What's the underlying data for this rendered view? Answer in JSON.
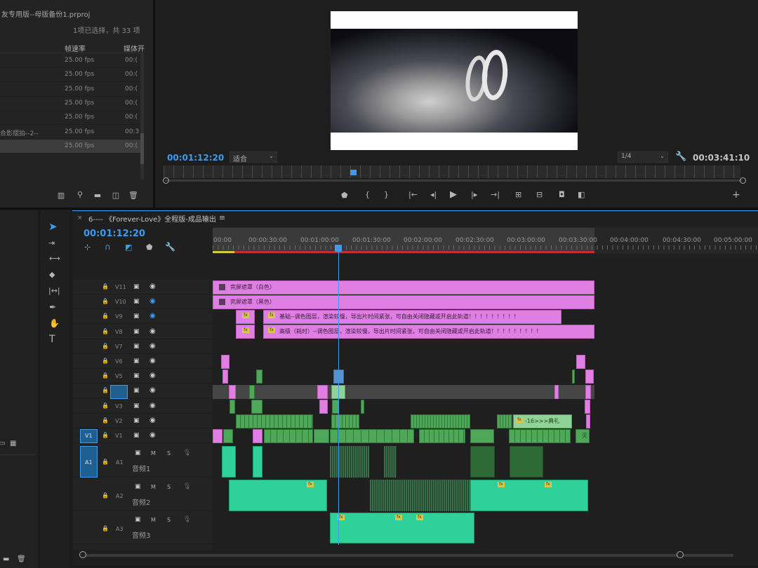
{
  "project": {
    "title": "友专用版--母版备份1.prproj",
    "selection_info": "1项已选择，共 33 项",
    "col_framerate": "帧速率",
    "col_media": "媒体开",
    "rows": [
      {
        "name": "",
        "fps": "25.00 fps",
        "dur": "00:("
      },
      {
        "name": "",
        "fps": "25.00 fps",
        "dur": "00:("
      },
      {
        "name": "",
        "fps": "25.00 fps",
        "dur": "00:("
      },
      {
        "name": "",
        "fps": "25.00 fps",
        "dur": "00:("
      },
      {
        "name": "",
        "fps": "25.00 fps",
        "dur": "00:("
      },
      {
        "name": "合影摆拍--2--",
        "fps": "25.00 fps",
        "dur": "00:3"
      },
      {
        "name": "",
        "fps": "25.00 fps",
        "dur": "00:("
      }
    ]
  },
  "program": {
    "timecode": "00:01:12:20",
    "fit": "适合",
    "resolution": "1/4",
    "duration": "00:03:41:10"
  },
  "timeline": {
    "tab_title": "6---- 《Forever-Love》全程版-成品输出",
    "timecode": "00:01:12:20",
    "ruler": [
      "00:00",
      "00:00:30:00",
      "00:01:00:00",
      "00:01:30:00",
      "00:02:00:00",
      "00:02:30:00",
      "00:03:00:00",
      "00:03:30:00",
      "00:04:00:00",
      "00:04:30:00",
      "00:05:00:00"
    ],
    "video_tracks": [
      "V11",
      "V10",
      "V9",
      "V8",
      "V7",
      "V6",
      "V5",
      "V4",
      "V3",
      "V2",
      "V1"
    ],
    "audio_tracks": [
      {
        "id": "A1",
        "name": "音频1"
      },
      {
        "id": "A2",
        "name": "音频2"
      },
      {
        "id": "A3",
        "name": "音频3"
      }
    ],
    "v1_source": "V1",
    "a1_source": "A1",
    "m_label": "M",
    "s_label": "S",
    "clips": {
      "v11": "完屏遮罩（白色）",
      "v10": "完屏遮罩（黑色）",
      "v9": "基础--调色图层，渲染较慢，导出片时间紧张，可自由关闭隐藏或开启此轨道！！！！！！！！！",
      "v8": "高级（耗时）--调色图层，渲染较慢，导出片时间紧张，可自由关闭隐藏或开启此轨道！！！！！！！！！",
      "v2_label": "-16>>>典礼",
      "v1_end": "灭"
    }
  },
  "colors": {
    "accent": "#3d9bf0",
    "pink": "#e07fe3",
    "green": "#4fa85a",
    "teal": "#2fd19a"
  }
}
